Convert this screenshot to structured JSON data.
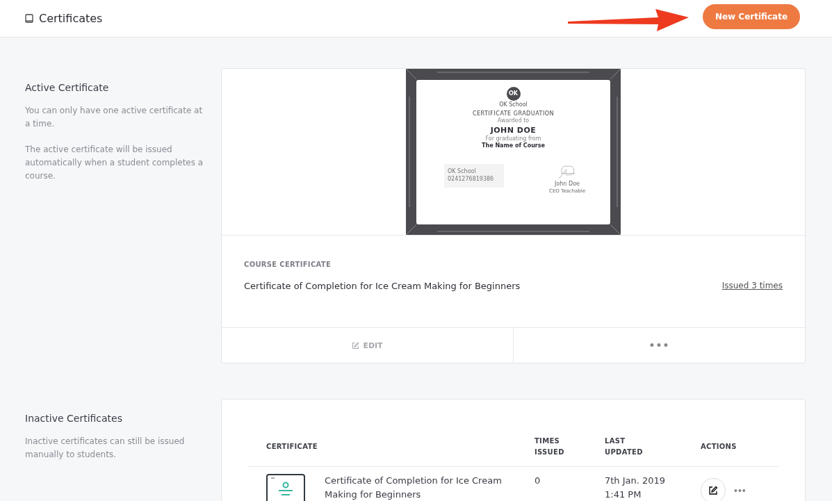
{
  "header": {
    "title": "Certificates",
    "button": "New Certificate"
  },
  "active_section": {
    "title": "Active Certificate",
    "paragraphs": [
      "You can only have one active certificate at a time.",
      "The active certificate will be issued automatically when a student completes a course."
    ]
  },
  "certificate_preview": {
    "logo": "OK",
    "school": "OK School",
    "heading": "CERTIFICATE GRADUATION",
    "awarded": "Awarded to",
    "name": "JOHN DOE",
    "for": "For graduating from",
    "course": "The Name of Course",
    "box_school": "OK School",
    "box_number": "0241276819386",
    "signer": "John Doe",
    "signer_role": "CEO Teachable"
  },
  "active_card": {
    "label": "COURSE CERTIFICATE",
    "name": "Certificate of Completion for Ice Cream Making for Beginners",
    "issued_link": "Issued 3 times",
    "edit": "EDIT",
    "more": "•••"
  },
  "inactive_section": {
    "title": "Inactive Certificates",
    "paragraphs": [
      "Inactive certificates can still be issued manually to students."
    ]
  },
  "table": {
    "columns": [
      "CERTIFICATE",
      "TIMES ISSUED",
      "LAST UPDATED",
      "ACTIONS"
    ],
    "rows": [
      {
        "name": "Certificate of Completion for Ice Cream Making for Beginners",
        "times_issued": "0",
        "updated": [
          "7th Jan. 2019",
          "1:41 PM"
        ],
        "more": "•••"
      }
    ]
  }
}
